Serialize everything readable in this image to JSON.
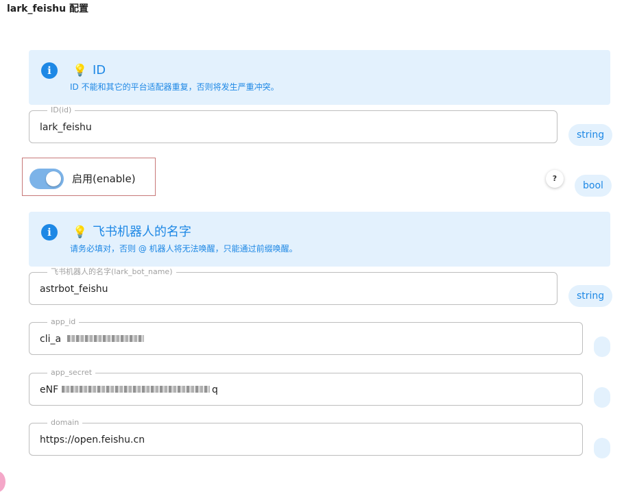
{
  "page_title": "lark_feishu 配置",
  "sections": {
    "id_info": {
      "icon": "info-icon",
      "title": "ID",
      "description": "ID 不能和其它的平台适配器重复，否则将发生严重冲突。"
    },
    "id_field": {
      "label": "ID(id)",
      "value": "lark_feishu",
      "type": "string"
    },
    "enable": {
      "label": "启用(enable)",
      "enabled": true,
      "help": "?",
      "type": "bool"
    },
    "bot_name_info": {
      "icon": "info-icon",
      "title": "飞书机器人的名字",
      "description": "请务必填对，否则 @ 机器人将无法唤醒，只能通过前缀唤醒。"
    },
    "bot_name_field": {
      "label": "飞书机器人的名字(lark_bot_name)",
      "value": "astrbot_feishu",
      "type": "string"
    },
    "app_id_field": {
      "label": "app_id",
      "value": "cli_a"
    },
    "app_secret_field": {
      "label": "app_secret",
      "value": "eNF"
    },
    "app_secret_suffix": "q",
    "domain_field": {
      "label": "domain",
      "value": "https://open.feishu.cn"
    }
  },
  "colors": {
    "accent": "#1e88e5",
    "info_bg": "#e3f1fd",
    "toggle_on": "#7cb3e8",
    "highlight_border": "#c77777"
  }
}
